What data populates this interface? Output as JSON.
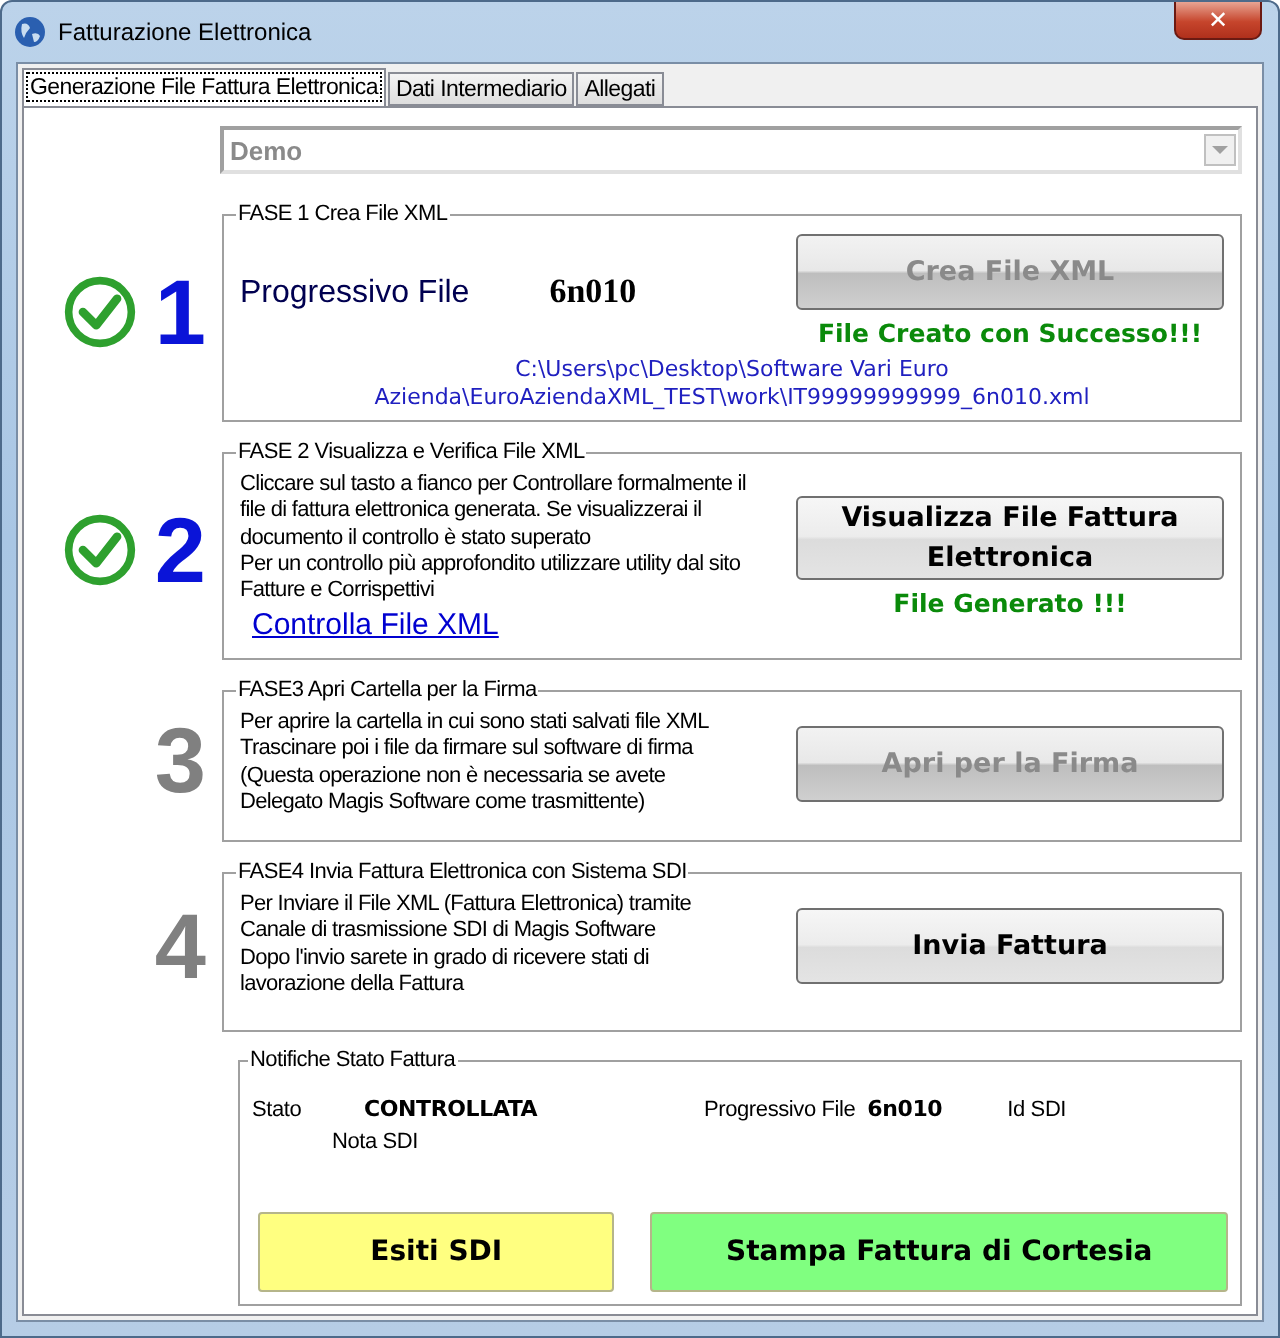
{
  "window": {
    "title": "Fatturazione Elettronica",
    "close": "✕"
  },
  "tabs": [
    {
      "label": "Generazione File Fattura Elettronica",
      "selected": true
    },
    {
      "label": "Dati Intermediario",
      "selected": false
    },
    {
      "label": "Allegati",
      "selected": false
    }
  ],
  "company_select": {
    "value": "Demo",
    "disabled": true
  },
  "phases": [
    {
      "number": "1",
      "done": true,
      "title": "FASE 1 Crea File XML",
      "progressivo_label": "Progressivo File",
      "progressivo_value": "6n010",
      "button": {
        "label": "Crea File XML",
        "disabled": true
      },
      "status": "File Creato con Successo!!!",
      "path": "C:\\Users\\pc\\Desktop\\Software Vari Euro Azienda\\EuroAziendaXML_TEST\\work\\IT99999999999_6n010.xml"
    },
    {
      "number": "2",
      "done": true,
      "title": "FASE 2 Visualizza e Verifica File XML",
      "description": [
        "Cliccare sul tasto a fianco per Controllare formalmente il",
        "file di fattura elettronica generata. Se visualizzerai il",
        "documento il controllo è stato superato",
        "Per un controllo più approfondito utilizzare utility dal sito",
        "Fatture e Corrispettivi"
      ],
      "link": "Controlla File XML",
      "button": {
        "label": "Visualizza File Fattura Elettronica",
        "disabled": false
      },
      "status": "File Generato !!!"
    },
    {
      "number": "3",
      "done": false,
      "title": "FASE3 Apri Cartella per la Firma",
      "description": [
        "Per aprire la cartella in cui sono stati salvati file XML",
        "Trascinare poi i file da firmare sul software di firma",
        "(Questa operazione non è necessaria se avete",
        "Delegato Magis Software come trasmittente)"
      ],
      "button": {
        "label": "Apri per la Firma",
        "disabled": true
      }
    },
    {
      "number": "4",
      "done": false,
      "title": "FASE4 Invia Fattura Elettronica con Sistema SDI",
      "description": [
        "Per Inviare il File XML (Fattura Elettronica) tramite",
        "Canale di trasmissione SDI di Magis Software",
        "Dopo l'invio sarete in grado di ricevere stati di",
        "lavorazione della Fattura"
      ],
      "button": {
        "label": "Invia Fattura",
        "disabled": false
      }
    }
  ],
  "notifications": {
    "title": "Notifiche Stato Fattura",
    "stato_label": "Stato",
    "stato_value": "CONTROLLATA",
    "progressivo_label": "Progressivo File",
    "progressivo_value": "6n010",
    "id_sdi_label": "Id SDI",
    "nota_sdi_label": "Nota SDI",
    "buttons": [
      {
        "label": "Esiti SDI",
        "color": "#ffff80"
      },
      {
        "label": "Stampa Fattura di Cortesia",
        "color": "#80ff80"
      }
    ]
  }
}
